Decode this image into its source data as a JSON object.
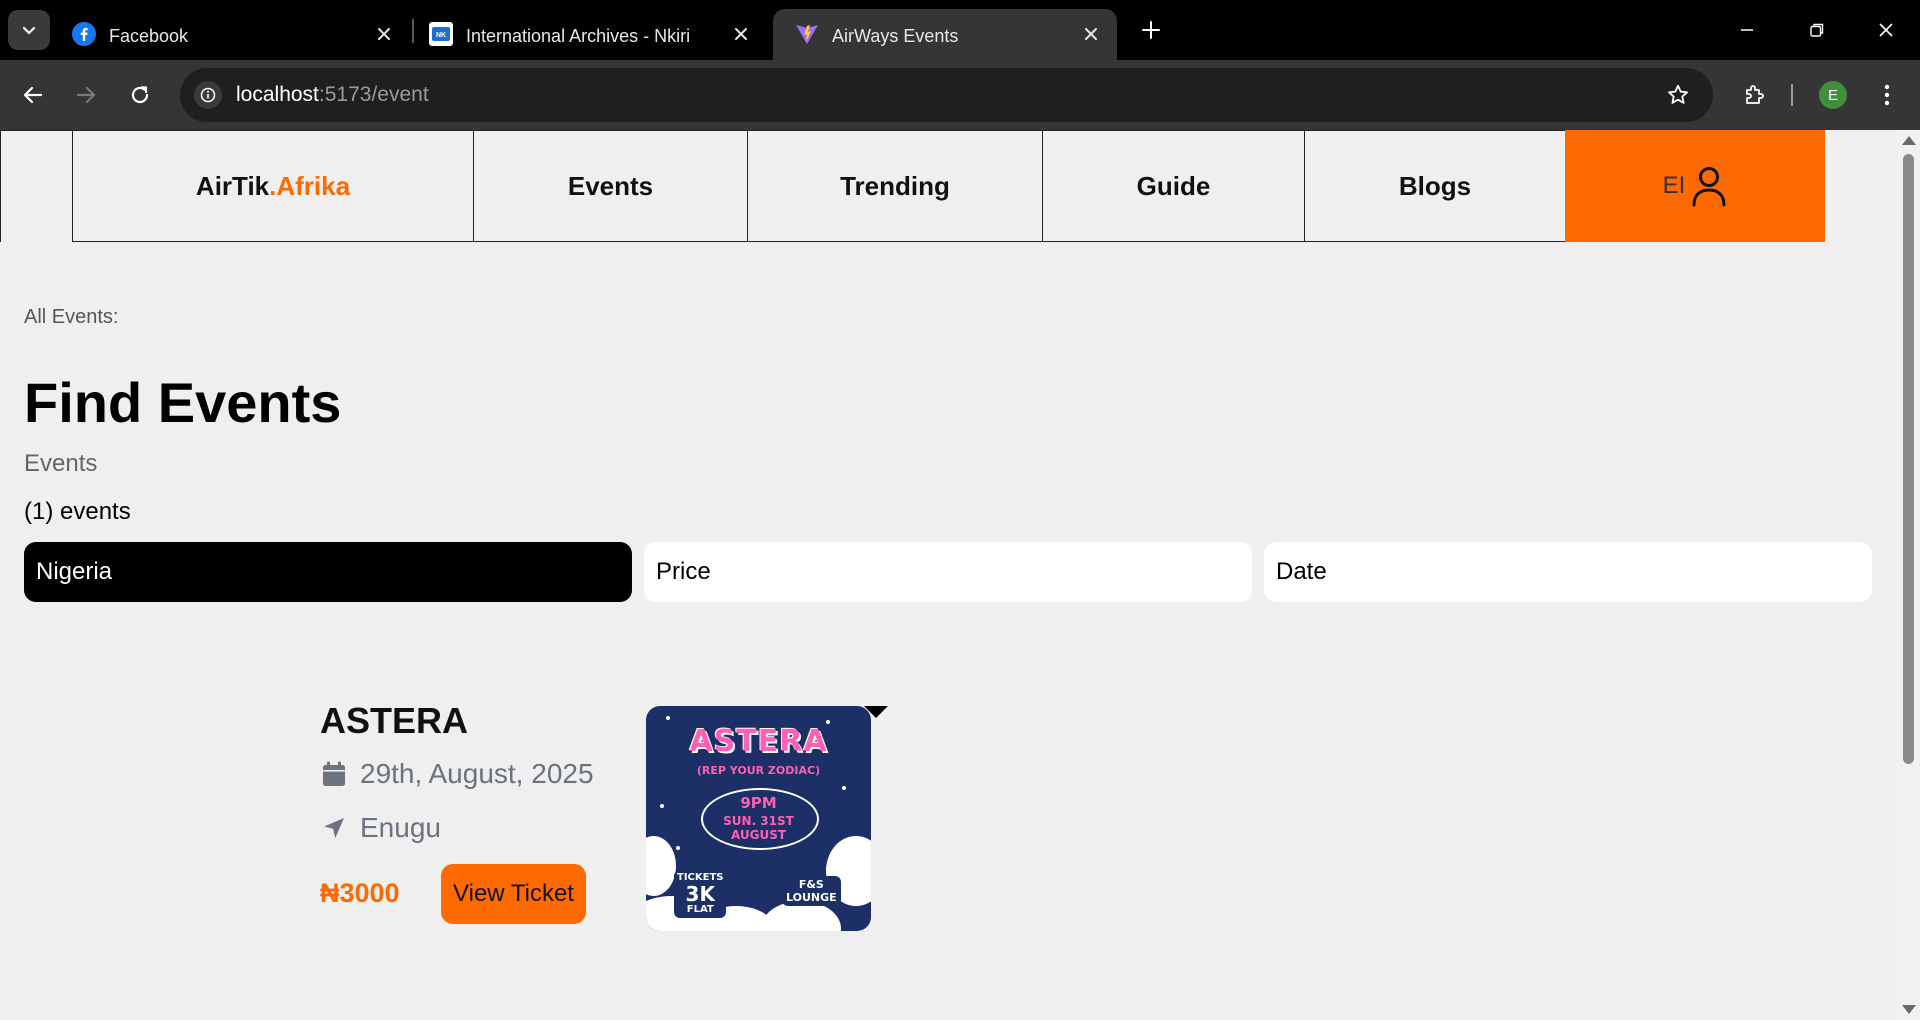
{
  "browser": {
    "tabs": [
      {
        "title": "Facebook",
        "favicon": "facebook-icon",
        "active": false
      },
      {
        "title": "International Archives - Nkiri",
        "favicon": "nkiri-icon",
        "active": false
      },
      {
        "title": "AirWays Events",
        "favicon": "vite-icon",
        "active": true
      }
    ],
    "url_host": "localhost",
    "url_path": ":5173/event",
    "profile_initial": "E",
    "colors": {
      "tabstrip": "#000000",
      "toolbar": "#353535",
      "omnibox": "#1f1f1f"
    }
  },
  "site": {
    "brand_part1": "AirTik",
    "brand_part2": ".Afrika",
    "nav": {
      "events": "Events",
      "trending": "Trending",
      "guide": "Guide",
      "blogs": "Blogs",
      "user_initials": "EI"
    },
    "colors": {
      "accent": "#ff6a00",
      "background": "#efefef"
    }
  },
  "page": {
    "breadcrumb": "All Events:",
    "title": "Find Events",
    "subtitle": "Events",
    "count": "(1) events",
    "filters": {
      "location": "Nigeria",
      "price": "Price",
      "date": "Date"
    }
  },
  "events": [
    {
      "title": "ASTERA",
      "date": "29th, August, 2025",
      "location": "Enugu",
      "price": "₦3000",
      "cta": "View Ticket",
      "poster": {
        "headline": "ASTERA",
        "tagline": "(REP YOUR ZODIAC)",
        "time": "9PM",
        "date_line1": "SUN. 31ST",
        "date_line2": "AUGUST",
        "tickets_label": "TICKETS",
        "tickets_price": "3K",
        "tickets_note": "FLAT",
        "venue_line1": "F&S",
        "venue_line2": "LOUNGE"
      }
    }
  ]
}
